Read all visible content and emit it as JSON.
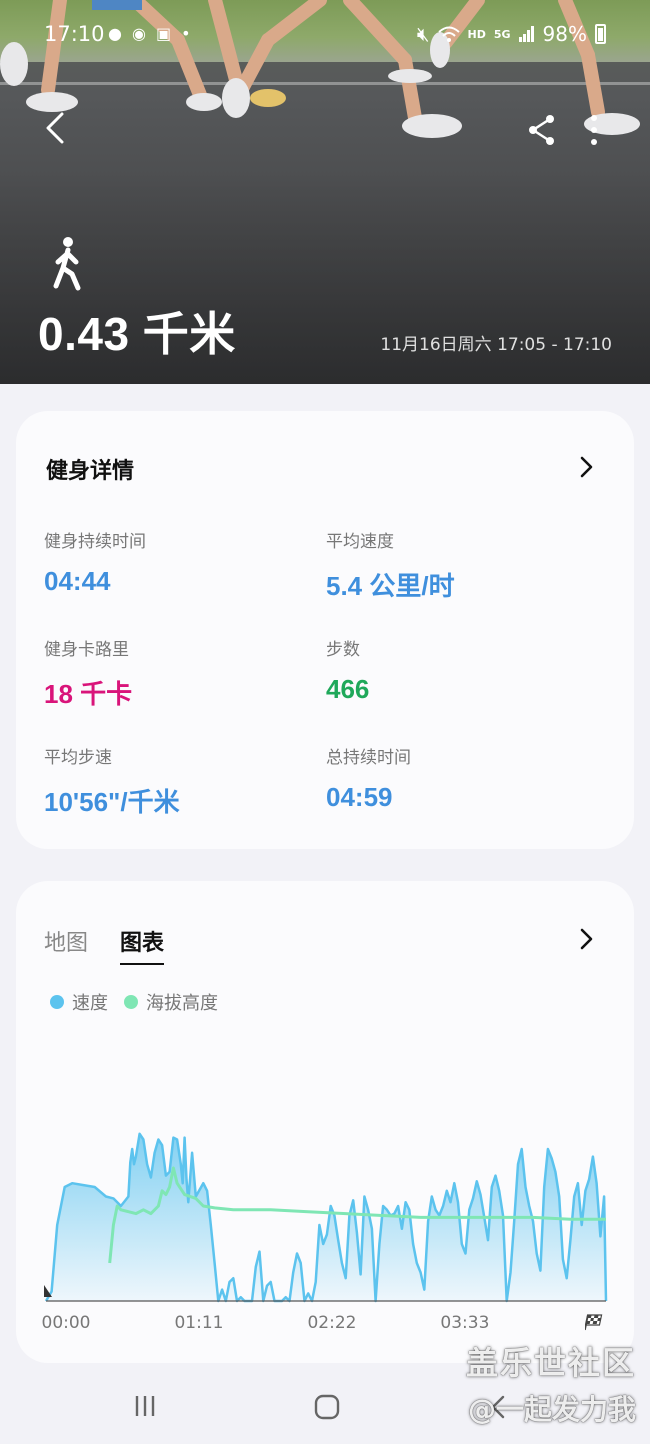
{
  "status_bar": {
    "time": "17:10",
    "left_icons": [
      "notification-icon",
      "weibo-icon",
      "app-icon"
    ],
    "network_hd": "HD",
    "network_gen": "5G",
    "battery": "98%"
  },
  "hero": {
    "activity_icon": "walking-icon",
    "distance": "0.43 千米",
    "datetime": "11月16日周六 17:05 - 17:10"
  },
  "details": {
    "title": "健身详情",
    "metrics": [
      {
        "label": "健身持续时间",
        "value": "04:44",
        "color": "#3f8fdd"
      },
      {
        "label": "平均速度",
        "value": "5.4 公里/时",
        "color": "#3f8fdd"
      },
      {
        "label": "健身卡路里",
        "value": "18 千卡",
        "color": "#d9147a"
      },
      {
        "label": "步数",
        "value": "466",
        "color": "#1fa85a"
      },
      {
        "label": "平均步速",
        "value": "10'56\"/千米",
        "color": "#3f8fdd"
      },
      {
        "label": "总持续时间",
        "value": "04:59",
        "color": "#3f8fdd"
      }
    ]
  },
  "chart_card": {
    "tabs": [
      {
        "label": "地图",
        "active": false
      },
      {
        "label": "图表",
        "active": true
      }
    ],
    "legend": [
      {
        "label": "速度",
        "color": "#5cc3ee"
      },
      {
        "label": "海拔高度",
        "color": "#7fe6b4"
      }
    ]
  },
  "chart_data": {
    "type": "area",
    "x_ticks": [
      "00:00",
      "01:11",
      "02:22",
      "03:33"
    ],
    "x_range_sec": [
      0,
      299
    ],
    "y_range": [
      0,
      1
    ],
    "series": [
      {
        "name": "速度",
        "color": "#5cc3ee",
        "x": [
          0,
          3,
          6,
          10,
          14,
          20,
          26,
          32,
          36,
          40,
          44,
          45,
          46,
          47,
          48,
          50,
          52,
          54,
          56,
          58,
          60,
          62,
          64,
          66,
          68,
          70,
          72,
          73,
          74,
          75,
          76,
          78,
          80,
          84,
          86,
          88,
          90,
          92,
          94,
          96,
          98,
          100,
          102,
          104,
          106,
          108,
          110,
          112,
          114,
          116,
          118,
          120,
          122,
          124,
          126,
          128,
          130,
          132,
          134,
          136,
          138,
          140,
          142,
          144,
          146,
          148,
          150,
          152,
          154,
          156,
          158,
          160,
          162,
          164,
          166,
          168,
          170,
          172,
          174,
          176,
          178,
          180,
          182,
          184,
          186,
          188,
          190,
          192,
          194,
          196,
          198,
          200,
          202,
          204,
          206,
          208,
          210,
          212,
          214,
          216,
          218,
          220,
          222,
          224,
          226,
          228,
          230,
          232,
          234,
          236,
          238,
          240,
          242,
          244,
          246,
          248,
          250,
          252,
          254,
          256,
          258,
          260,
          262,
          264,
          266,
          268,
          270,
          272,
          274,
          276,
          278,
          280,
          282,
          284,
          286,
          288,
          290,
          292,
          294,
          296,
          298,
          299
        ],
        "y": [
          0.0,
          0.05,
          0.4,
          0.6,
          0.62,
          0.61,
          0.6,
          0.55,
          0.54,
          0.5,
          0.55,
          0.73,
          0.8,
          0.72,
          0.76,
          0.88,
          0.85,
          0.72,
          0.65,
          0.78,
          0.85,
          0.82,
          0.66,
          0.68,
          0.86,
          0.85,
          0.72,
          0.62,
          0.86,
          0.64,
          0.52,
          0.78,
          0.55,
          0.62,
          0.58,
          0.4,
          0.2,
          0.0,
          0.06,
          0.0,
          0.1,
          0.12,
          0.0,
          0.02,
          0.0,
          0.0,
          0.0,
          0.18,
          0.26,
          0.0,
          0.08,
          0.1,
          0.0,
          0.0,
          0.0,
          0.02,
          0.0,
          0.15,
          0.25,
          0.2,
          0.0,
          0.04,
          0.0,
          0.1,
          0.4,
          0.3,
          0.35,
          0.5,
          0.45,
          0.32,
          0.2,
          0.12,
          0.45,
          0.53,
          0.36,
          0.14,
          0.55,
          0.48,
          0.38,
          0.0,
          0.3,
          0.5,
          0.48,
          0.45,
          0.46,
          0.5,
          0.38,
          0.52,
          0.48,
          0.3,
          0.2,
          0.15,
          0.06,
          0.42,
          0.55,
          0.48,
          0.45,
          0.5,
          0.58,
          0.52,
          0.62,
          0.52,
          0.3,
          0.25,
          0.48,
          0.54,
          0.63,
          0.56,
          0.44,
          0.32,
          0.6,
          0.66,
          0.58,
          0.45,
          0.0,
          0.15,
          0.42,
          0.72,
          0.8,
          0.6,
          0.5,
          0.42,
          0.25,
          0.16,
          0.6,
          0.8,
          0.75,
          0.68,
          0.55,
          0.22,
          0.12,
          0.32,
          0.55,
          0.62,
          0.4,
          0.58,
          0.64,
          0.76,
          0.62,
          0.34,
          0.55,
          0.0
        ]
      },
      {
        "name": "海拔高度",
        "color": "#7fe6b4",
        "x": [
          34,
          36,
          38,
          40,
          44,
          48,
          52,
          56,
          60,
          62,
          64,
          66,
          68,
          70,
          74,
          80,
          84,
          90,
          100,
          120,
          140,
          160,
          180,
          200,
          220,
          240,
          260,
          280,
          299
        ],
        "y": [
          0.2,
          0.4,
          0.5,
          0.48,
          0.47,
          0.46,
          0.48,
          0.46,
          0.5,
          0.58,
          0.56,
          0.6,
          0.7,
          0.62,
          0.56,
          0.54,
          0.5,
          0.49,
          0.48,
          0.48,
          0.47,
          0.46,
          0.45,
          0.44,
          0.44,
          0.44,
          0.44,
          0.43,
          0.43
        ]
      }
    ],
    "grid": false,
    "legend_position": "top-left"
  },
  "nav": {
    "recent": "recent-apps-icon",
    "home": "home-icon",
    "back": "back-icon"
  },
  "watermark": {
    "line1": "盖乐世社区",
    "line2": "@一起发力我"
  }
}
